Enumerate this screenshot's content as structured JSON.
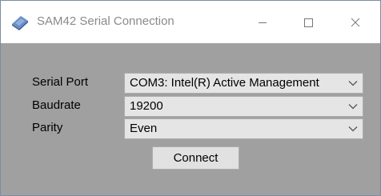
{
  "window": {
    "title": "SAM42 Serial Connection"
  },
  "icons": {
    "app": "app-logo-icon",
    "minimize": "minimize-icon",
    "maximize": "maximize-icon",
    "close": "close-icon",
    "dropdown": "chevron-down-icon"
  },
  "form": {
    "serial_port": {
      "label": "Serial Port",
      "value": "COM3: Intel(R) Active Management"
    },
    "baudrate": {
      "label": "Baudrate",
      "value": "19200"
    },
    "parity": {
      "label": "Parity",
      "value": "Even"
    },
    "connect_label": "Connect"
  },
  "colors": {
    "client_background": "#a0a0a0",
    "icon_blue": "#4a78b5"
  }
}
